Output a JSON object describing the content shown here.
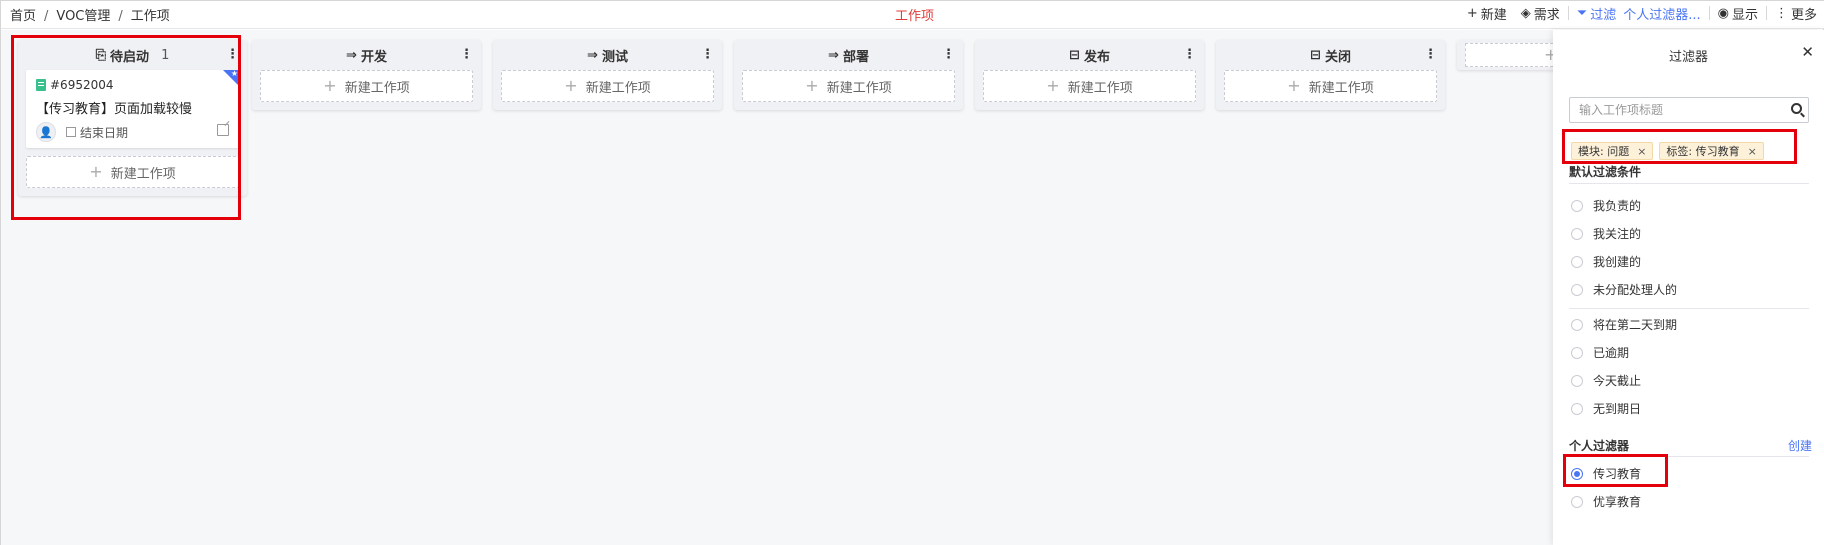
{
  "breadcrumb": {
    "items": [
      "首页",
      "VOC管理",
      "工作项"
    ],
    "separator": "/"
  },
  "page": {
    "title": "工作项"
  },
  "toolbar": {
    "new_label": "新建",
    "requirement_label": "需求",
    "filter_label": "过滤",
    "filter_value": "个人过滤器...",
    "display_label": "显示",
    "more_label": "更多"
  },
  "columns": [
    {
      "title": "待启动",
      "icon": "start-icon",
      "count": "1"
    },
    {
      "title": "开发",
      "icon": "arrow-icon"
    },
    {
      "title": "测试",
      "icon": "arrow-icon"
    },
    {
      "title": "部署",
      "icon": "arrow-icon"
    },
    {
      "title": "发布",
      "icon": "box-icon"
    },
    {
      "title": "关闭",
      "icon": "box-icon"
    }
  ],
  "new_item_label": "新建工作项",
  "card": {
    "id": "#6952004",
    "title": "【传习教育】页面加载较慢",
    "end_date_label": "结束日期"
  },
  "filter_panel": {
    "title": "过滤器",
    "search_placeholder": "输入工作项标题",
    "tags": [
      {
        "label": "模块: 问题"
      },
      {
        "label": "标签: 传习教育"
      }
    ],
    "default_section_title": "默认过滤条件",
    "default_options": [
      "我负责的",
      "我关注的",
      "我创建的",
      "未分配处理人的"
    ],
    "date_options": [
      "将在第二天到期",
      "已逾期",
      "今天截止",
      "无到期日"
    ],
    "personal_section_title": "个人过滤器",
    "create_label": "创建",
    "personal_options": [
      {
        "label": "传习教育",
        "checked": true
      },
      {
        "label": "优享教育",
        "checked": false
      }
    ]
  },
  "colors": {
    "accent": "#4a74f5",
    "highlight": "#e3000b",
    "title_red": "#e03b3b",
    "tag_bg": "#fdf1d9",
    "card_green": "#3ac08d"
  }
}
